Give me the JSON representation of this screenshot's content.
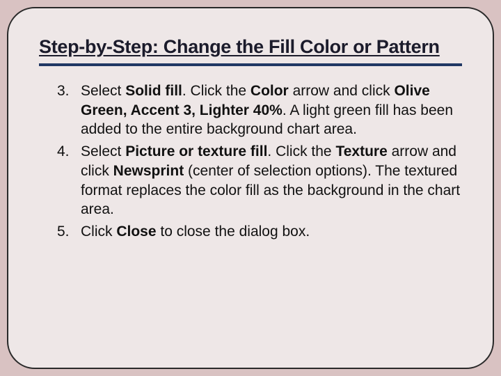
{
  "title": "Step-by-Step: Change the Fill Color or Pattern",
  "start_number": 3,
  "steps": [
    {
      "num": "3.",
      "segments": [
        {
          "t": "Select ",
          "b": false
        },
        {
          "t": "Solid fill",
          "b": true
        },
        {
          "t": ". Click the ",
          "b": false
        },
        {
          "t": "Color",
          "b": true
        },
        {
          "t": " arrow and click ",
          "b": false
        },
        {
          "t": "Olive Green, Accent 3, Lighter 40%",
          "b": true
        },
        {
          "t": ". A light green fill has been added to the entire background chart area.",
          "b": false
        }
      ]
    },
    {
      "num": "4.",
      "segments": [
        {
          "t": "Select ",
          "b": false
        },
        {
          "t": "Picture or texture fill",
          "b": true
        },
        {
          "t": ". Click the ",
          "b": false
        },
        {
          "t": "Texture",
          "b": true
        },
        {
          "t": " arrow and click ",
          "b": false
        },
        {
          "t": "Newsprint",
          "b": true
        },
        {
          "t": " (center of selection options). The textured format replaces the color fill as the background in the chart area.",
          "b": false
        }
      ]
    },
    {
      "num": "5.",
      "segments": [
        {
          "t": "Click ",
          "b": false
        },
        {
          "t": "Close",
          "b": true
        },
        {
          "t": " to close the dialog box.",
          "b": false
        }
      ]
    }
  ]
}
